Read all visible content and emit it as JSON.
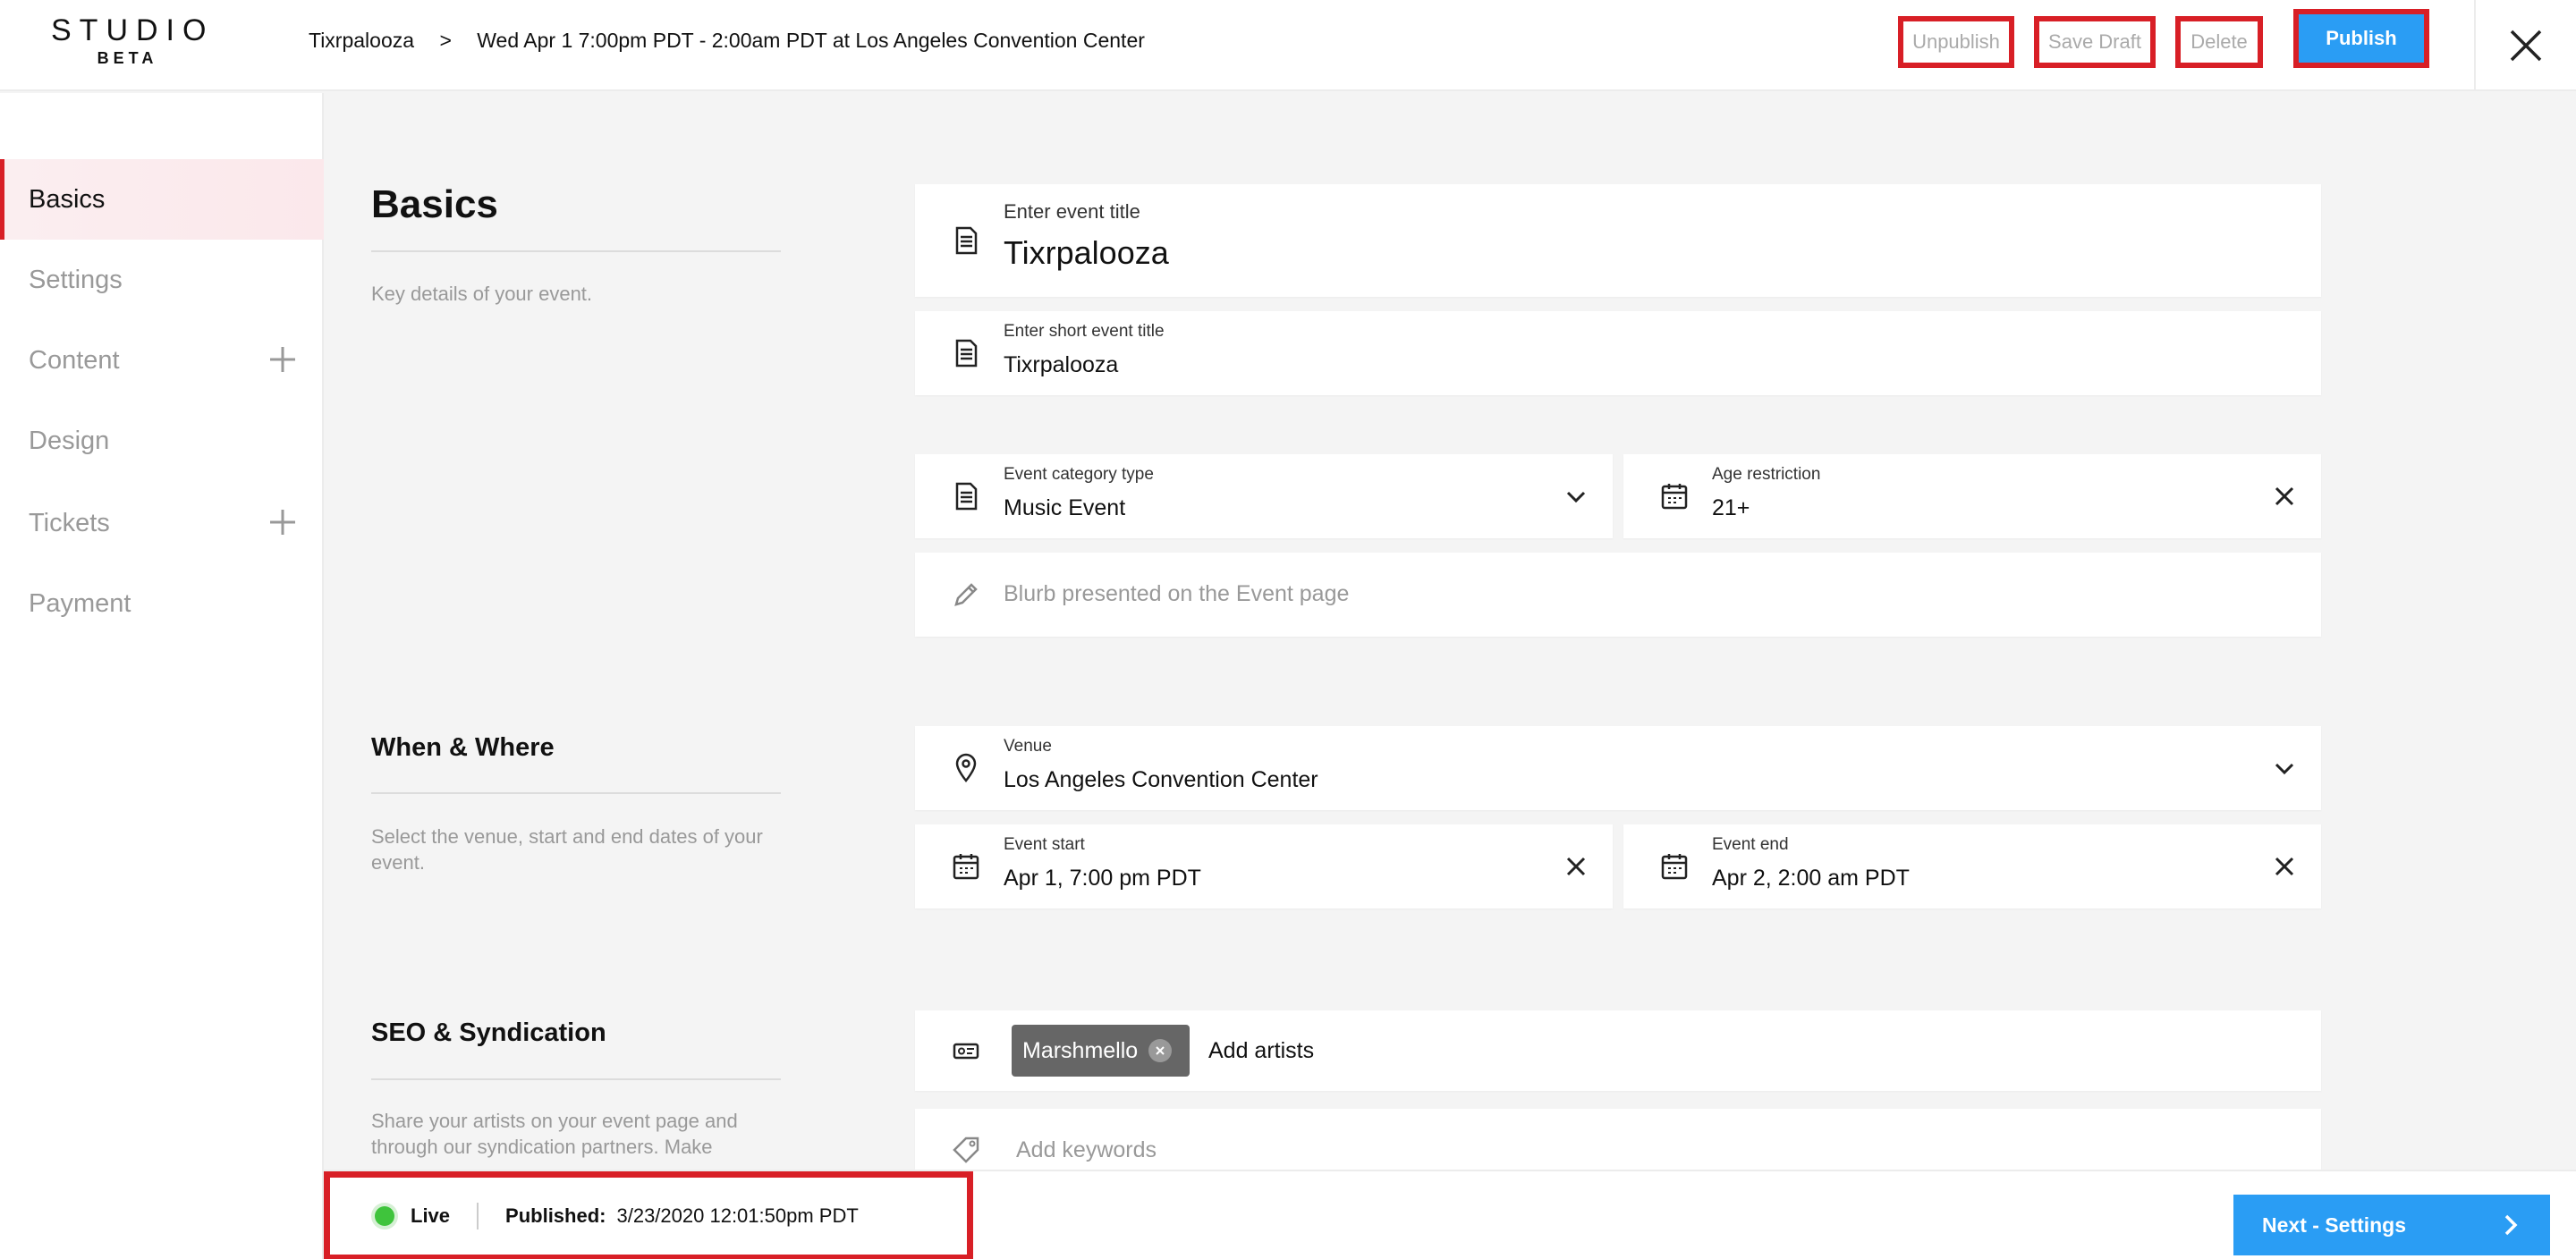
{
  "header": {
    "logo_main": "STUDIO",
    "logo_sub": "BETA",
    "breadcrumb": {
      "event": "Tixrpalooza",
      "separator": ">",
      "detail": "Wed Apr 1 7:00pm PDT - 2:00am PDT at Los Angeles Convention Center"
    },
    "buttons": {
      "unpublish": "Unpublish",
      "save_draft": "Save Draft",
      "delete": "Delete",
      "publish": "Publish"
    }
  },
  "sidebar": {
    "items": [
      {
        "label": "Basics",
        "active": true
      },
      {
        "label": "Settings"
      },
      {
        "label": "Content",
        "has_add": true
      },
      {
        "label": "Design"
      },
      {
        "label": "Tickets",
        "has_add": true
      },
      {
        "label": "Payment"
      }
    ]
  },
  "sections": {
    "basics": {
      "title": "Basics",
      "description": "Key details of your event."
    },
    "when_where": {
      "title": "When & Where",
      "description": "Select the venue, start and end dates of your event."
    },
    "seo": {
      "title": "SEO & Syndication",
      "description": "Share your artists on your event page and through our syndication partners. Make"
    }
  },
  "fields": {
    "event_title": {
      "label": "Enter event title",
      "value": "Tixrpalooza"
    },
    "short_title": {
      "label": "Enter short event title",
      "value": "Tixrpalooza"
    },
    "category": {
      "label": "Event category type",
      "value": "Music Event"
    },
    "age": {
      "label": "Age restriction",
      "value": "21+"
    },
    "blurb": {
      "placeholder": "Blurb presented on the Event page"
    },
    "venue": {
      "label": "Venue",
      "value": "Los Angeles Convention Center"
    },
    "event_start": {
      "label": "Event start",
      "value": "Apr 1, 7:00 pm PDT"
    },
    "event_end": {
      "label": "Event end",
      "value": "Apr 2, 2:00 am PDT"
    },
    "artists": {
      "chips": [
        "Marshmello"
      ],
      "placeholder": "Add artists"
    },
    "keywords": {
      "placeholder": "Add keywords"
    }
  },
  "footer": {
    "status": "Live",
    "published_label": "Published:",
    "published_value": "3/23/2020 12:01:50pm PDT",
    "next_button": "Next - Settings"
  },
  "colors": {
    "accent_blue": "#2a9df4",
    "highlight_red": "#d81f26",
    "live_green": "#3fc43c"
  }
}
